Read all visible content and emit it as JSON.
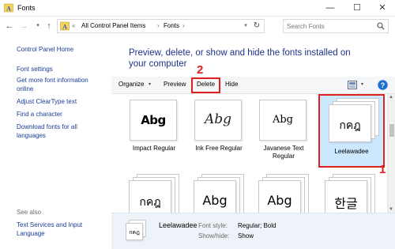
{
  "window": {
    "title": "Fonts",
    "minimize_glyph": "—",
    "maximize_glyph": "☐",
    "close_glyph": "✕",
    "icon": "fonts-folder-icon"
  },
  "address_bar": {
    "back_glyph": "←",
    "forward_glyph": "→",
    "recent_glyph": "▾",
    "up_glyph": "↑",
    "overflow": "«",
    "crumbs": [
      "All Control Panel Items",
      "Fonts"
    ],
    "separator": "›",
    "dropdown_glyph": "▾",
    "refresh_glyph": "↻"
  },
  "search": {
    "placeholder": "Search Fonts",
    "value": ""
  },
  "left_pane": {
    "home": "Control Panel Home",
    "links": [
      "Font settings",
      "Get more font information online",
      "Adjust ClearType text",
      "Find a character",
      "Download fonts for all languages"
    ],
    "see_also_heading": "See also",
    "see_also_links": [
      "Text Services and Input Language"
    ]
  },
  "main": {
    "heading": "Preview, delete, or show and hide the fonts installed on your computer",
    "toolbar": {
      "organize": "Organize",
      "organize_arrow": "▾",
      "preview": "Preview",
      "delete": "Delete",
      "hide": "Hide",
      "view_dropdown": "▾",
      "help": "?"
    },
    "fonts": [
      {
        "name": "Impact Regular",
        "sample": "Abg",
        "stacked": false
      },
      {
        "name": "Ink Free Regular",
        "sample": "Abg",
        "stacked": false
      },
      {
        "name": "Javanese Text Regular",
        "sample": "Abg",
        "stacked": false
      },
      {
        "name": "Leelawadee",
        "sample": "กคฎ",
        "stacked": true,
        "selected": true
      },
      {
        "name": "",
        "sample": "กคฎ",
        "stacked": true
      },
      {
        "name": "",
        "sample": "Abg",
        "stacked": true
      },
      {
        "name": "",
        "sample": "Abg",
        "stacked": true
      },
      {
        "name": "",
        "sample": "한글",
        "stacked": true
      }
    ],
    "scrollbar": {
      "up_glyph": "▲",
      "down_glyph": "▼"
    }
  },
  "annotations": {
    "step1": "1",
    "step2": "2",
    "highlight_color": "#e0201f"
  },
  "details": {
    "font_name": "Leelawadee",
    "sample": "กคฎ",
    "font_style_label": "Font style:",
    "font_style_value": "Regular; Bold",
    "show_hide_label": "Show/hide:",
    "show_hide_value": "Show"
  },
  "colors": {
    "link": "#1a3e96",
    "heading": "#1e3287",
    "selection": "#cce8ff",
    "details_bg": "#eef3fa"
  }
}
